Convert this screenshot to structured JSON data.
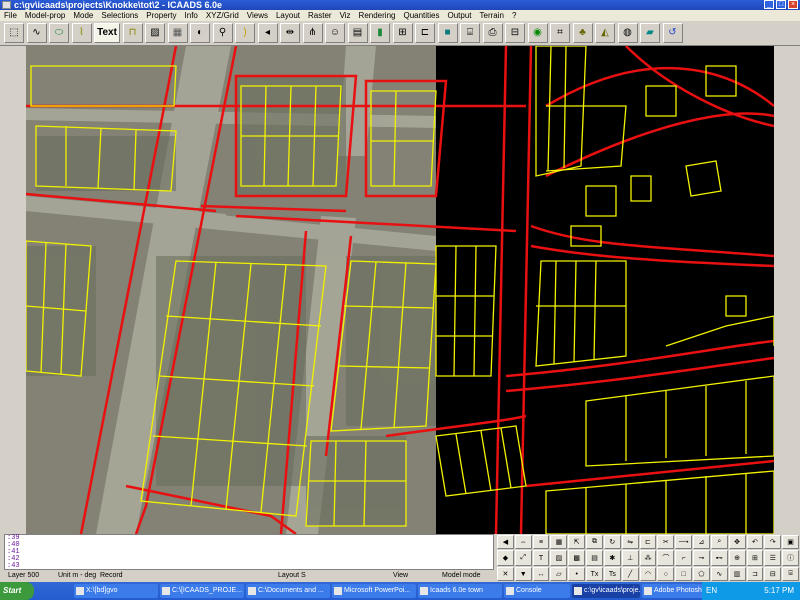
{
  "window": {
    "title": "c:\\gv\\icaads\\projects\\Knokke\\tot\\2 - ICAADS 6.0e"
  },
  "menu": [
    "File",
    "Model-prop",
    "Mode",
    "Selections",
    "Property",
    "Info",
    "XYZ/Grid",
    "Views",
    "Layout",
    "Raster",
    "Viz",
    "Rendering",
    "Quantities",
    "Output",
    "Terrain",
    "?"
  ],
  "toolbar": {
    "text_button": "Text"
  },
  "command_lines": [
    ":39",
    ":40",
    ":41",
    ":42",
    ":43"
  ],
  "status": {
    "layer": "Layer 500",
    "unit": "Unit m - deg",
    "record": "Record",
    "layout": "Layout  S",
    "view": "View",
    "model_mode": "Model mode"
  },
  "taskbar": {
    "start": "Start",
    "items": [
      "X:\\[bd]gvo",
      "C:\\[ICAADS_PROJE...",
      "C:\\Documents and ...",
      "Microsoft PowerPoi...",
      "Icaads 6.0e town",
      "Console",
      "c:\\gv\\icaads\\proje...",
      "Adobe Photoshop"
    ],
    "lang": "EN",
    "clock": "5:17 PM"
  },
  "colors": {
    "plot_red": "#e81010",
    "plot_yellow": "#f2f200"
  }
}
